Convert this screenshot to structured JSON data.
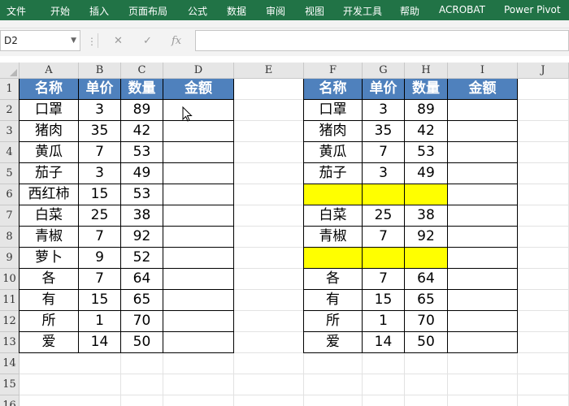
{
  "ribbon": {
    "tabs": [
      "文件",
      "开始",
      "插入",
      "页面布局",
      "公式",
      "数据",
      "审阅",
      "视图",
      "开发工具",
      "帮助",
      "ACROBAT",
      "Power Pivot"
    ]
  },
  "formula_bar": {
    "name_box": "D2",
    "formula": ""
  },
  "columns": [
    "A",
    "B",
    "C",
    "D",
    "E",
    "F",
    "G",
    "H",
    "I",
    "J"
  ],
  "rows": [
    "1",
    "2",
    "3",
    "4",
    "5",
    "6",
    "7",
    "8",
    "9",
    "10",
    "11",
    "12",
    "13",
    "14",
    "15",
    "16"
  ],
  "left_table": {
    "headers": [
      "名称",
      "单价",
      "数量",
      "金额"
    ],
    "rows": [
      [
        "口罩",
        "3",
        "89",
        ""
      ],
      [
        "猪肉",
        "35",
        "42",
        ""
      ],
      [
        "黄瓜",
        "7",
        "53",
        ""
      ],
      [
        "茄子",
        "3",
        "49",
        ""
      ],
      [
        "西红柿",
        "15",
        "53",
        ""
      ],
      [
        "白菜",
        "25",
        "38",
        ""
      ],
      [
        "青椒",
        "7",
        "92",
        ""
      ],
      [
        "萝卜",
        "9",
        "52",
        ""
      ],
      [
        "各",
        "7",
        "64",
        ""
      ],
      [
        "有",
        "15",
        "65",
        ""
      ],
      [
        "所",
        "1",
        "70",
        ""
      ],
      [
        "爱",
        "14",
        "50",
        ""
      ]
    ]
  },
  "right_table": {
    "headers": [
      "名称",
      "单价",
      "数量",
      "金额"
    ],
    "rows": [
      [
        "口罩",
        "3",
        "89",
        ""
      ],
      [
        "猪肉",
        "35",
        "42",
        ""
      ],
      [
        "黄瓜",
        "7",
        "53",
        ""
      ],
      [
        "茄子",
        "3",
        "49",
        ""
      ],
      [
        "",
        "",
        "",
        ""
      ],
      [
        "白菜",
        "25",
        "38",
        ""
      ],
      [
        "青椒",
        "7",
        "92",
        ""
      ],
      [
        "",
        "",
        "",
        ""
      ],
      [
        "各",
        "7",
        "64",
        ""
      ],
      [
        "有",
        "15",
        "65",
        ""
      ],
      [
        "所",
        "1",
        "70",
        ""
      ],
      [
        "爱",
        "14",
        "50",
        ""
      ]
    ],
    "highlighted_rows": [
      4,
      7
    ],
    "highlight_color": "#ffff00"
  },
  "colors": {
    "ribbon": "#217346",
    "header_fill": "#4f81bd"
  }
}
